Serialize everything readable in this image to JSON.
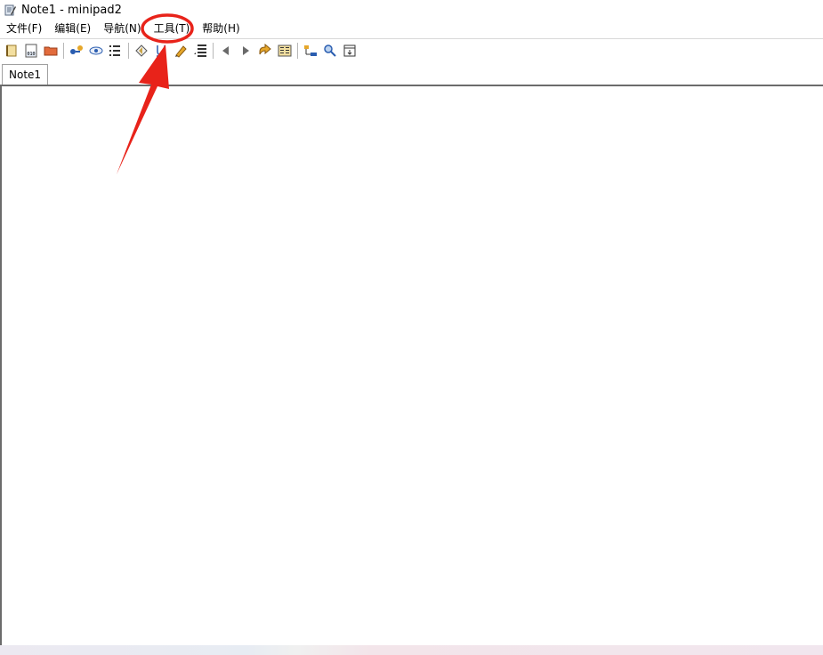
{
  "window": {
    "title": "Note1 - minipad2"
  },
  "menu": {
    "items": [
      {
        "label": "文件(F)"
      },
      {
        "label": "编辑(E)"
      },
      {
        "label": "导航(N)"
      },
      {
        "label": "工具(T)"
      },
      {
        "label": "帮助(H)"
      }
    ]
  },
  "toolbar": {
    "buttons": [
      "new-note-icon",
      "binary-file-icon",
      "open-folder-icon",
      "add-link-icon",
      "view-eye-icon",
      "list-view-icon",
      "back-diamond-icon",
      "underline-template-icon",
      "pencil-edit-icon",
      "line-numbers-icon",
      "previous-arrow-icon",
      "next-arrow-icon",
      "share-export-icon",
      "columns-icon",
      "tree-structure-icon",
      "pin-search-icon",
      "insert-frame-icon"
    ]
  },
  "tabs": [
    {
      "label": "Note1"
    }
  ],
  "annotation": {
    "color": "#e8231a"
  }
}
